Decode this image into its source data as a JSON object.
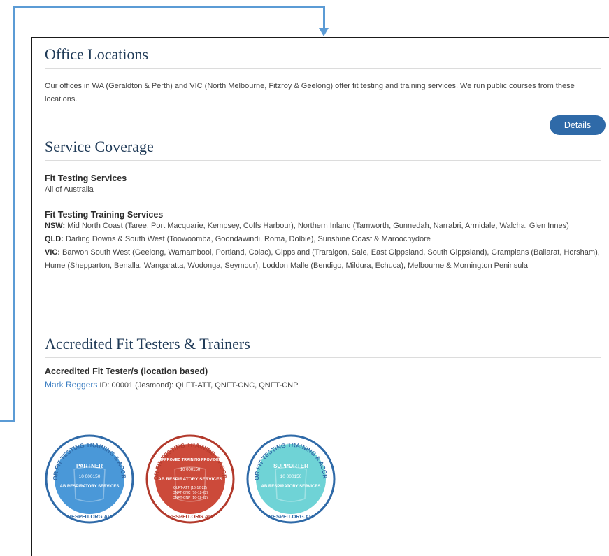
{
  "office": {
    "title": "Office Locations",
    "text": "Our offices in WA (Geraldton & Perth) and VIC (North Melbourne, Fitzroy & Geelong) offer fit testing and training services. We run public courses from these locations.",
    "details_label": "Details"
  },
  "coverage": {
    "title": "Service Coverage",
    "fit_testing": {
      "heading": "Fit Testing Services",
      "text": "All of Australia"
    },
    "training": {
      "heading": "Fit Testing Training Services",
      "regions": [
        {
          "state": "NSW:",
          "text": " Mid North Coast (Taree, Port Macquarie, Kempsey, Coffs Harbour), Northern Inland (Tamworth, Gunnedah, Narrabri, Armidale, Walcha, Glen Innes)"
        },
        {
          "state": "QLD:",
          "text": " Darling Downs & South West (Toowoomba, Goondawindi, Roma, Dolbie), Sunshine Coast & Maroochydore"
        },
        {
          "state": "VIC:",
          "text": " Barwon South West (Geelong, Warnambool, Portland, Colac), Gippsland (Traralgon, Sale, East Gippsland, South Gippsland), Grampians (Ballarat, Horsham), Hume (Shepparton, Benalla, Wangaratta, Wodonga, Seymour), Loddon Malle (Bendigo, Mildura, Echuca), Melbourne & Mornington Peninsula"
        }
      ]
    }
  },
  "accredited": {
    "title": "Accredited Fit Testers & Trainers",
    "subheading": "Accredited Fit Tester/s (location based)",
    "tester_name": "Mark Reggers",
    "tester_details": " ID: 00001 (Jesmond): QLFT-ATT, QNFT-CNC, QNFT-CNP"
  },
  "badges": [
    {
      "ring_text": "RESPIRATOR FIT TESTING TRAINING & ACCREDITATION",
      "banner": "PARTNER",
      "id": "10 000150",
      "org": "AB RESPIRATORY SERVICES",
      "footer": "RESPFIT.ORG.AU",
      "color": "#4a98d8",
      "ring": "#ffffff"
    },
    {
      "ring_text": "RESPIRATOR FIT TESTING TRAINING & ACCREDITATION",
      "banner": "APPROVED TRAINING PROVIDER",
      "id": "10 000150",
      "org": "AB RESPIRATORY SERVICES",
      "codes": [
        "QLFT-ATT (16-12-22)",
        "QNFT-CNC (16-12-22)",
        "QNFT-CNP (16-12-22)"
      ],
      "footer": "RESPFIT.ORG.AU",
      "color": "#cc4a3a",
      "ring": "#ffffff"
    },
    {
      "ring_text": "RESPIRATOR FIT TESTING TRAINING & ACCREDITATION",
      "banner": "SUPPORTER",
      "id": "10 000150",
      "org": "AB RESPIRATORY SERVICES",
      "footer": "RESPFIT.ORG.AU",
      "color": "#6fd3d6",
      "ring": "#ffffff"
    }
  ]
}
